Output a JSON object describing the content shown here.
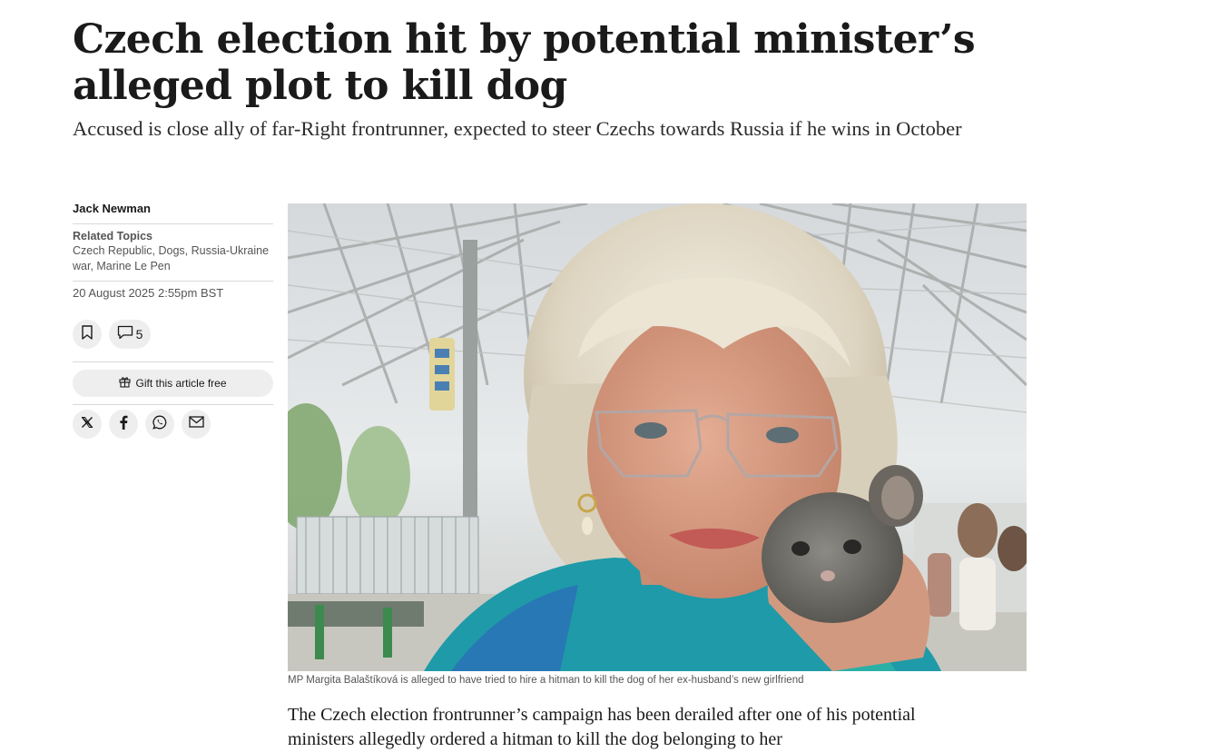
{
  "article": {
    "headline": "Czech election hit by potential minister’s alleged plot to kill dog",
    "standfirst": "Accused is close ally of far-Right frontrunner, expected to steer Czechs towards Russia if he wins in October",
    "author": "Jack Newman",
    "related_topics": {
      "title": "Related Topics",
      "links": "Czech Republic, Dogs, Russia-Ukraine war, Marine Le Pen"
    },
    "timestamp": "20 August 2025 2:55pm BST",
    "comment_count": "5",
    "gift_label": "Gift this article free",
    "share_icons": [
      "x-icon",
      "facebook-icon",
      "whatsapp-icon",
      "email-icon"
    ],
    "image_caption": "MP Margita Balaštíková is alleged to have tried to hire a hitman to kill the dog of her ex-husband’s new girlfriend",
    "body_opening": "The Czech election frontrunner’s campaign has been derailed after one of his potential ministers allegedly ordered a hitman to kill the dog belonging to her"
  },
  "colors": {
    "text": "#1a1a1a",
    "muted": "#555555",
    "button_bg": "#eeeeee",
    "rule": "#d9d9d9"
  }
}
